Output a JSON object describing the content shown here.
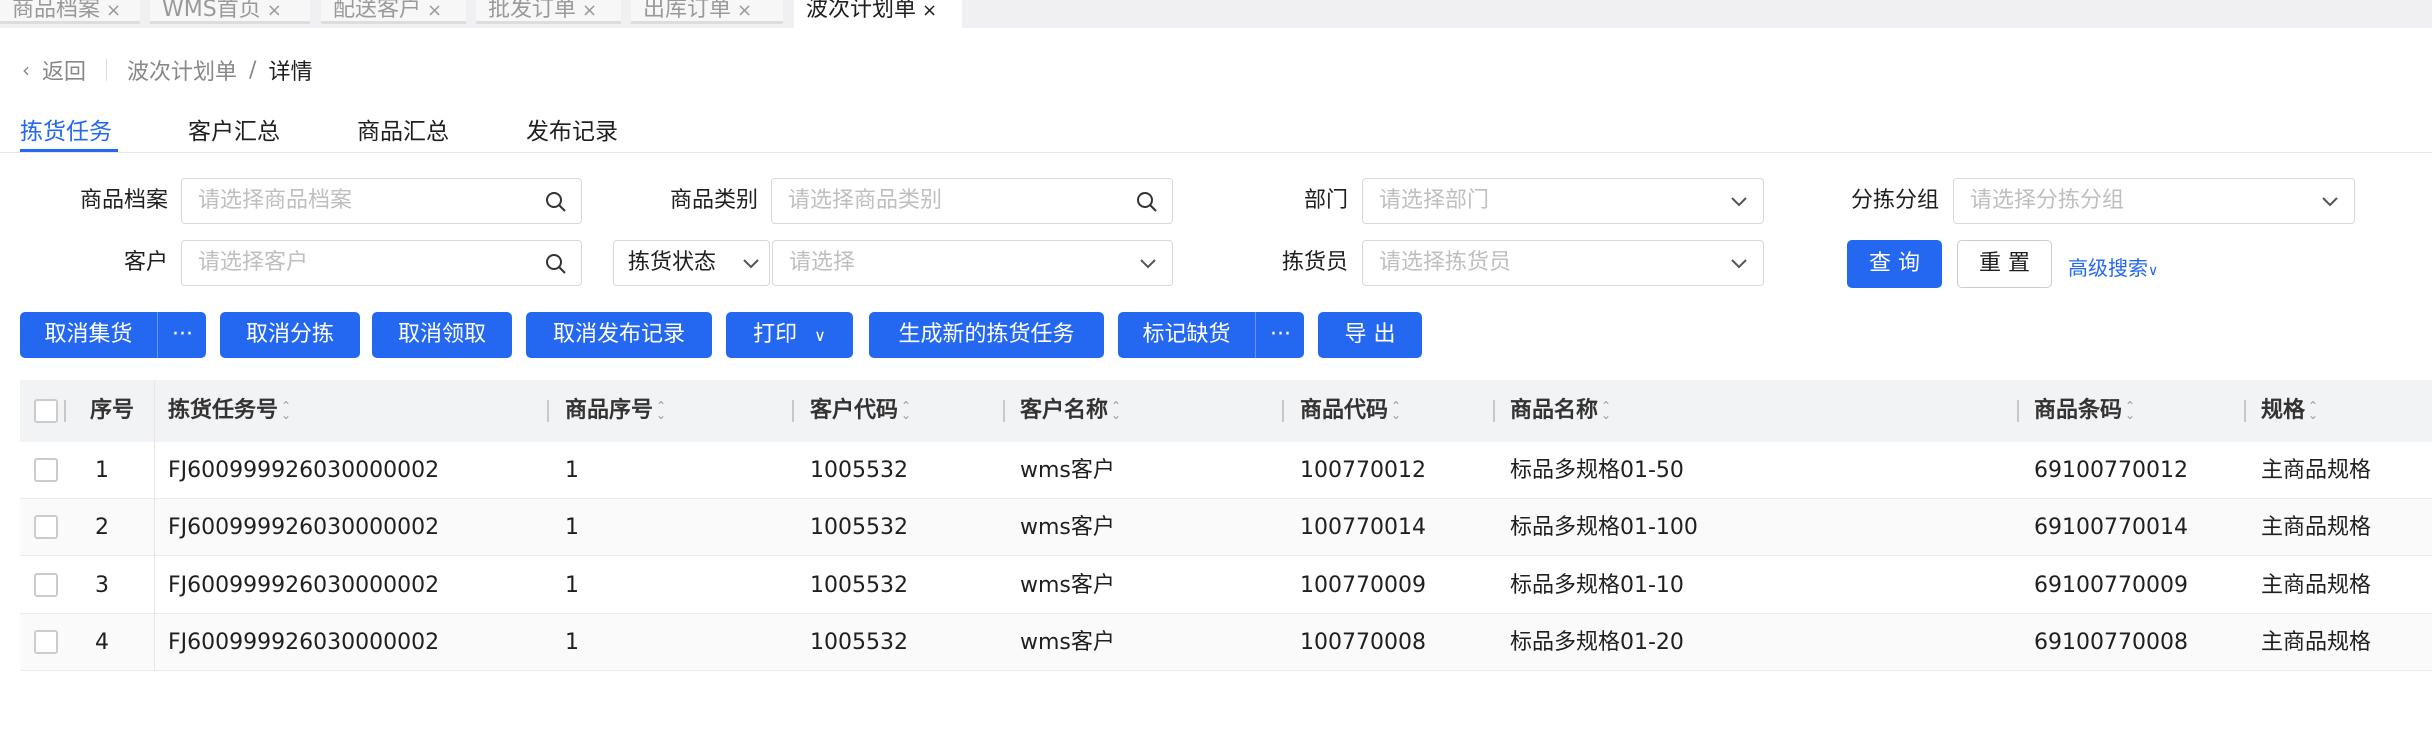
{
  "window_tabs": [
    {
      "label": "商品档案"
    },
    {
      "label": "WMS首页"
    },
    {
      "label": "配送客户"
    },
    {
      "label": "批发订单"
    },
    {
      "label": "出库订单"
    },
    {
      "label": "波次计划单",
      "active": true
    }
  ],
  "close_glyph": "×",
  "breadcrumb": {
    "back": "返回",
    "parent": "波次计划单",
    "sep": "/",
    "current": "详情"
  },
  "page_tabs": [
    "拣货任务",
    "客户汇总",
    "商品汇总",
    "发布记录"
  ],
  "filters": {
    "product_file": {
      "label": "商品档案",
      "placeholder": "请选择商品档案"
    },
    "product_category": {
      "label": "商品类别",
      "placeholder": "请选择商品类别"
    },
    "department": {
      "label": "部门",
      "placeholder": "请选择部门"
    },
    "sort_group": {
      "label": "分拣分组",
      "placeholder": "请选择分拣分组"
    },
    "customer": {
      "label": "客户",
      "placeholder": "请选择客户"
    },
    "pick_status": {
      "label": "拣货状态",
      "placeholder": "请选择"
    },
    "picker": {
      "label": "拣货员",
      "placeholder": "请选择拣货员"
    },
    "query": "查 询",
    "reset": "重 置",
    "advanced": "高级搜索"
  },
  "toolbar": {
    "cancel_collect": "取消集货",
    "more": "···",
    "cancel_sort": "取消分拣",
    "cancel_claim": "取消领取",
    "cancel_publish": "取消发布记录",
    "print": "打印",
    "generate": "生成新的拣货任务",
    "mark_short": "标记缺货",
    "export": "导 出"
  },
  "colors": {
    "primary": "#2468f2",
    "header_bg": "#f2f3f5"
  },
  "table": {
    "columns": [
      "序号",
      "拣货任务号",
      "商品序号",
      "客户代码",
      "客户名称",
      "商品代码",
      "商品名称",
      "商品条码",
      "规格"
    ],
    "rows": [
      [
        "1",
        "FJ600999926030000002",
        "1",
        "1005532",
        "wms客户",
        "100770012",
        "标品多规格01-50",
        "69100770012",
        "主商品规格"
      ],
      [
        "2",
        "FJ600999926030000002",
        "1",
        "1005532",
        "wms客户",
        "100770014",
        "标品多规格01-100",
        "69100770014",
        "主商品规格"
      ],
      [
        "3",
        "FJ600999926030000002",
        "1",
        "1005532",
        "wms客户",
        "100770009",
        "标品多规格01-10",
        "69100770009",
        "主商品规格"
      ],
      [
        "4",
        "FJ600999926030000002",
        "1",
        "1005532",
        "wms客户",
        "100770008",
        "标品多规格01-20",
        "69100770008",
        "主商品规格"
      ]
    ]
  }
}
